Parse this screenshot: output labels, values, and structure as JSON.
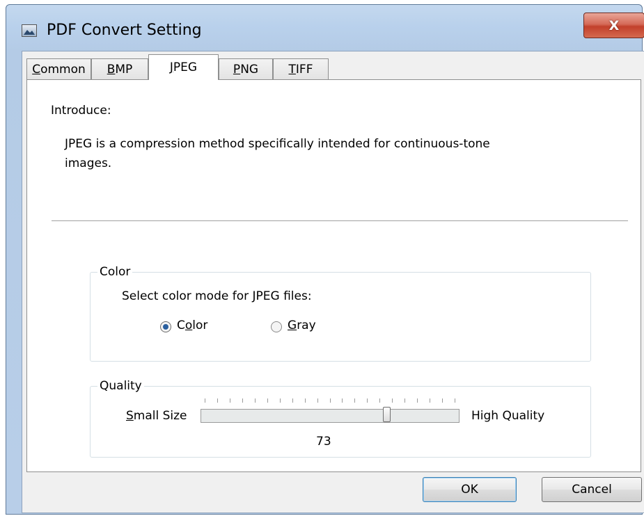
{
  "window": {
    "title": "PDF Convert Setting",
    "close_label": "X"
  },
  "tabs": [
    {
      "label": "Common",
      "mnemonic": "C",
      "rest": "ommon"
    },
    {
      "label": "BMP",
      "mnemonic": "B",
      "rest": "MP"
    },
    {
      "label": "JPEG",
      "mnemonic": "J",
      "rest": "PEG"
    },
    {
      "label": "PNG",
      "mnemonic": "P",
      "rest": "NG"
    },
    {
      "label": "TIFF",
      "mnemonic": "T",
      "rest": "IFF"
    }
  ],
  "active_tab": "JPEG",
  "introduce": {
    "heading": "Introduce:",
    "line1": "JPEG is a compression method specifically intended for continuous-tone",
    "line2": "images."
  },
  "color_group": {
    "legend": "Color",
    "prompt": "Select color mode for JPEG files:",
    "options": [
      {
        "label": "Color",
        "pre": "C",
        "mnemonic": "o",
        "post": "lor",
        "selected": true
      },
      {
        "label": "Gray",
        "pre": "",
        "mnemonic": "G",
        "post": "ray",
        "selected": false
      }
    ]
  },
  "quality_group": {
    "legend": "Quality",
    "min_label_mnemonic": "S",
    "min_label_rest": "mall Size",
    "max_label": "High Quality",
    "value": 73,
    "value_text": "73",
    "min": 0,
    "max": 100
  },
  "buttons": {
    "ok_label": "OK",
    "cancel_label": "Cancel"
  },
  "colors": {
    "title_bar": "#b9d1ec",
    "close_button": "#c7503b",
    "radio_selected": "#2a5f9e",
    "ok_border": "#3c7fb1"
  }
}
